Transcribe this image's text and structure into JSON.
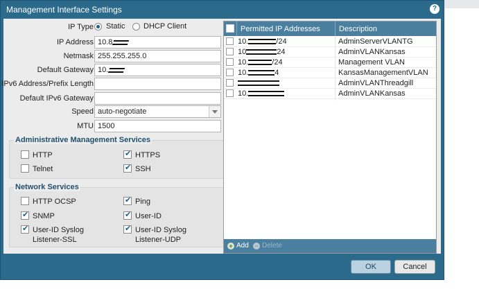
{
  "dialog": {
    "title": "Management Interface Settings",
    "help_icon": "?"
  },
  "form": {
    "ip_type": {
      "label": "IP Type",
      "options": [
        "Static",
        "DHCP Client"
      ],
      "selected": "Static"
    },
    "ip_address": {
      "label": "IP Address",
      "value": "10.8"
    },
    "netmask": {
      "label": "Netmask",
      "value": "255.255.255.0"
    },
    "default_gateway": {
      "label": "Default Gateway",
      "value": "10."
    },
    "ipv6_address": {
      "label": "IPv6 Address/Prefix Length",
      "value": ""
    },
    "default_ipv6_gateway": {
      "label": "Default IPv6 Gateway",
      "value": ""
    },
    "speed": {
      "label": "Speed",
      "value": "auto-negotiate"
    },
    "mtu": {
      "label": "MTU",
      "value": "1500"
    }
  },
  "admin_services": {
    "title": "Administrative Management Services",
    "items": [
      {
        "label": "HTTP",
        "checked": false
      },
      {
        "label": "HTTPS",
        "checked": true
      },
      {
        "label": "Telnet",
        "checked": false
      },
      {
        "label": "SSH",
        "checked": true
      }
    ]
  },
  "network_services": {
    "title": "Network Services",
    "items": [
      {
        "label": "HTTP OCSP",
        "checked": false
      },
      {
        "label": "Ping",
        "checked": true
      },
      {
        "label": "SNMP",
        "checked": true
      },
      {
        "label": "User-ID",
        "checked": true
      },
      {
        "label": "User-ID Syslog Listener-SSL",
        "checked": true
      },
      {
        "label": "User-ID Syslog Listener-UDP",
        "checked": true
      }
    ]
  },
  "permitted_ips": {
    "columns": [
      "Permitted IP Addresses",
      "Description"
    ],
    "rows": [
      {
        "ip": "10.",
        "suffix": "/24",
        "description": "AdminServerVLANTG"
      },
      {
        "ip": "10",
        "suffix": "24",
        "description": "AdminVLANKansas"
      },
      {
        "ip": "10.",
        "suffix": "/24",
        "description": "Management VLAN"
      },
      {
        "ip": "10.",
        "suffix": "4",
        "description": "KansasManagementVLAN"
      },
      {
        "ip": "",
        "suffix": "",
        "description": "AdminVLANThreadgill"
      },
      {
        "ip": "10.",
        "suffix": "",
        "description": "AdminVLANKansas"
      }
    ],
    "add_label": "Add",
    "delete_label": "Delete"
  },
  "buttons": {
    "ok": "OK",
    "cancel": "Cancel"
  }
}
